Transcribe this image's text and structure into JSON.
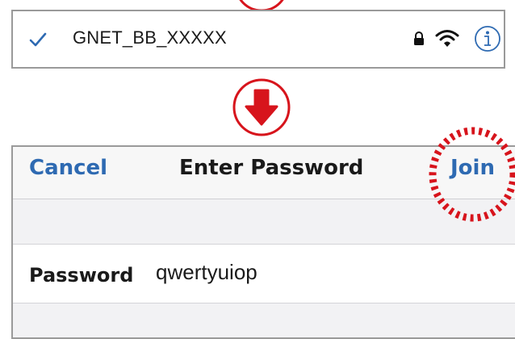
{
  "wifi_row": {
    "selected": true,
    "network_name": "GNET_BB_XXXXX",
    "icons": [
      "checkmark-icon",
      "lock-icon",
      "wifi-signal-icon",
      "info-icon"
    ]
  },
  "step_markers": {
    "arrow_icon": "arrow-down-icon"
  },
  "password_dialog": {
    "cancel_label": "Cancel",
    "title": "Enter Password",
    "join_label": "Join",
    "field": {
      "label": "Password",
      "value": "qwertyuiop"
    }
  },
  "colors": {
    "accent_blue": "#2e6ab2",
    "highlight_red": "#d7141c",
    "border_gray": "#9a9a9a"
  }
}
